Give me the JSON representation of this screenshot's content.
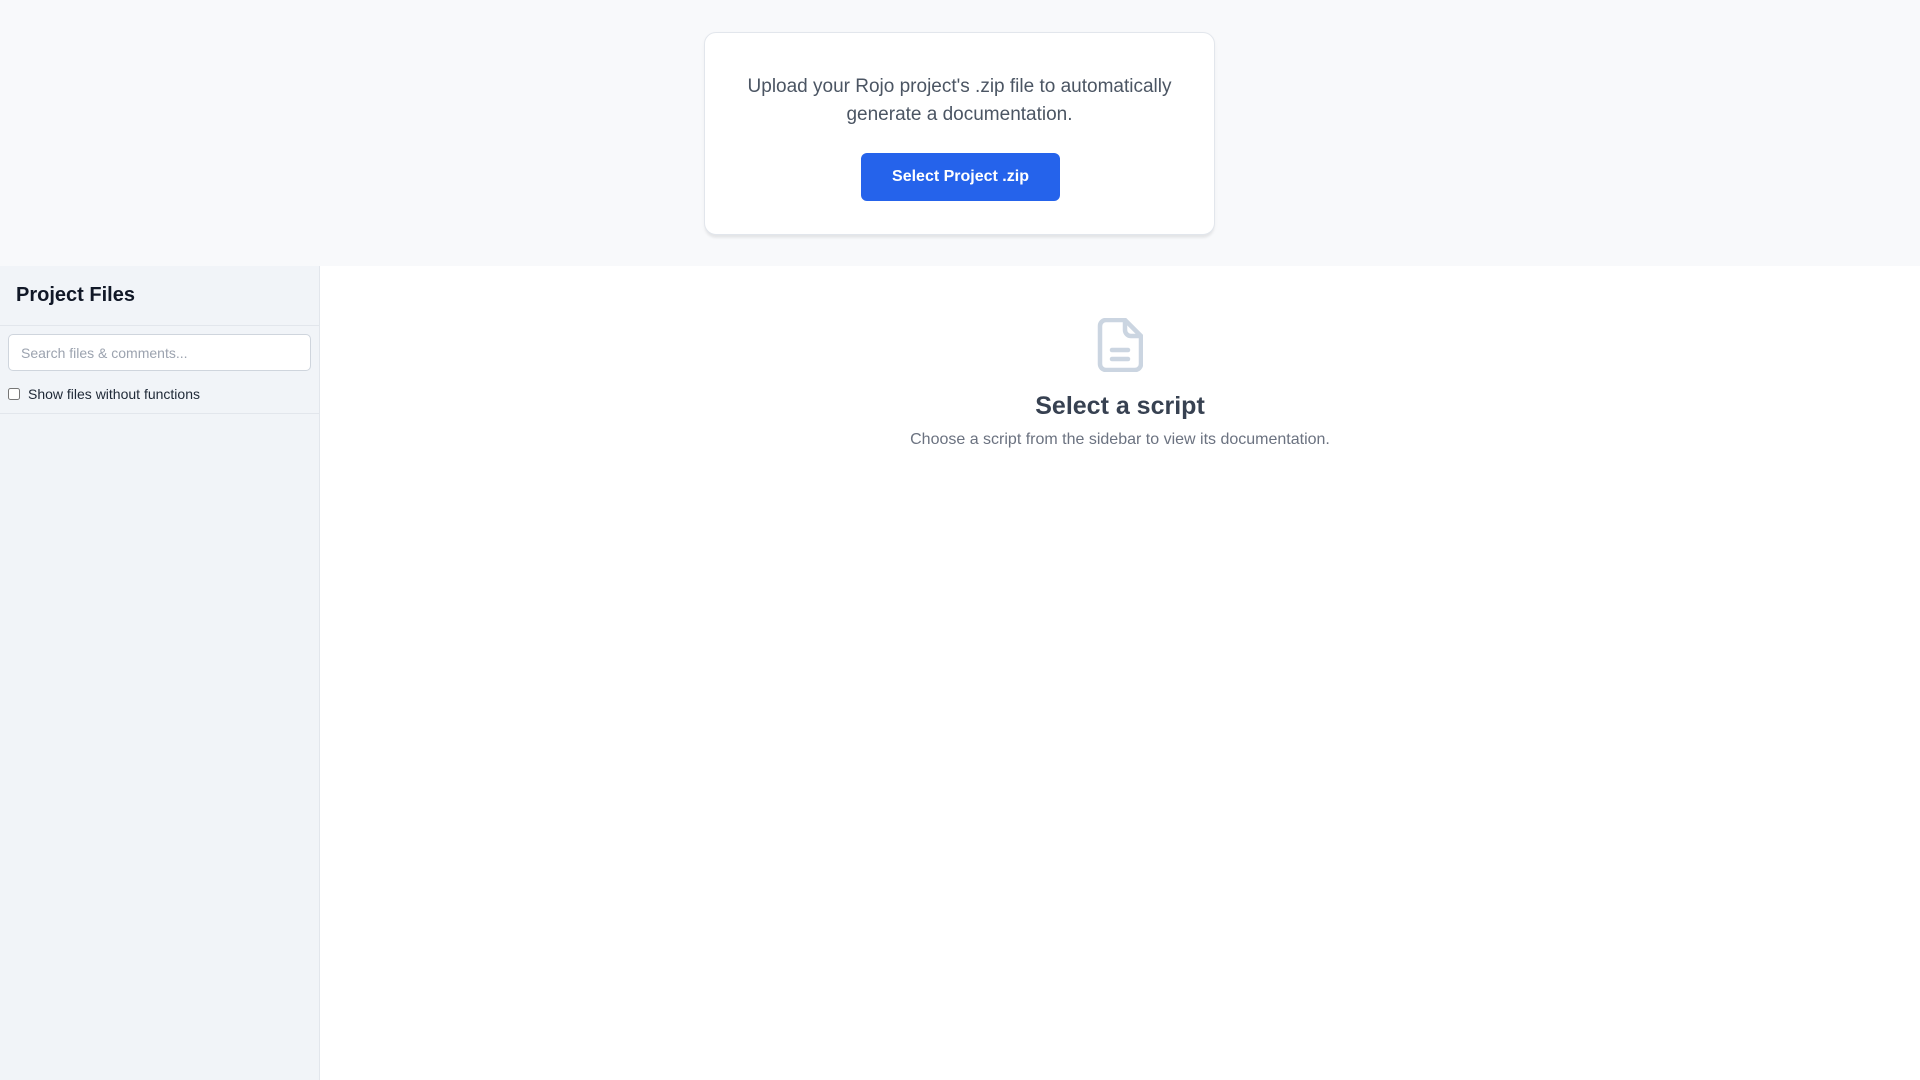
{
  "upload": {
    "description": "Upload your Rojo project's .zip file to automatically generate a documentation.",
    "button_label": "Select Project .zip"
  },
  "sidebar": {
    "title": "Project Files",
    "search_placeholder": "Search files & comments...",
    "search_value": "",
    "filter_label": "Show files without functions",
    "filter_checked": false
  },
  "main": {
    "icon": "document-icon",
    "empty_title": "Select a script",
    "empty_subtitle": "Choose a script from the sidebar to view its documentation."
  },
  "colors": {
    "accent": "#2563eb",
    "sidebar_bg": "#f1f4f8",
    "icon_gray": "#cbd5e1"
  }
}
